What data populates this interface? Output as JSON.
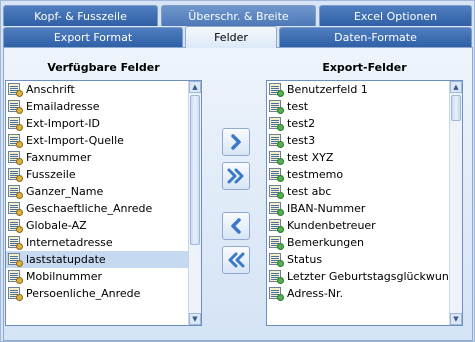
{
  "tabs_row1": [
    {
      "label": "Kopf- & Fusszeile"
    },
    {
      "label": "Überschr. & Breite"
    },
    {
      "label": "Excel Optionen"
    }
  ],
  "tabs_row2": [
    {
      "label": "Export Format"
    },
    {
      "label": "Felder",
      "active": true
    },
    {
      "label": "Daten-Formate"
    }
  ],
  "available": {
    "title": "Verfügbare Felder",
    "items": [
      "Anschrift",
      "Emailadresse",
      "Ext-Import-ID",
      "Ext-Import-Quelle",
      "Faxnummer",
      "Fusszeile",
      "Ganzer_Name",
      "Geschaeftliche_Anrede",
      "Globale-AZ",
      "Internetadresse",
      "laststatupdate",
      "Mobilnummer",
      "Persoenliche_Anrede"
    ],
    "selected_index": 10
  },
  "export": {
    "title": "Export-Felder",
    "items": [
      "Benutzerfeld 1",
      "test",
      "test2",
      "test3",
      "test XYZ",
      "testmemo",
      "test abc",
      "IBAN-Nummer",
      "Kundenbetreuer",
      "Bemerkungen",
      "Status",
      "Letzter Geburtstagsglückwunsch",
      "Adress-Nr."
    ]
  },
  "buttons": {
    "add_one": "chevron-right-icon",
    "add_all": "double-chevron-right-icon",
    "remove_one": "chevron-left-icon",
    "remove_all": "double-chevron-left-icon"
  },
  "colors": {
    "tab_blue": "#3a6bb0",
    "selected_row": "#c5d9f1",
    "arrow_blue": "#3b78c8"
  }
}
